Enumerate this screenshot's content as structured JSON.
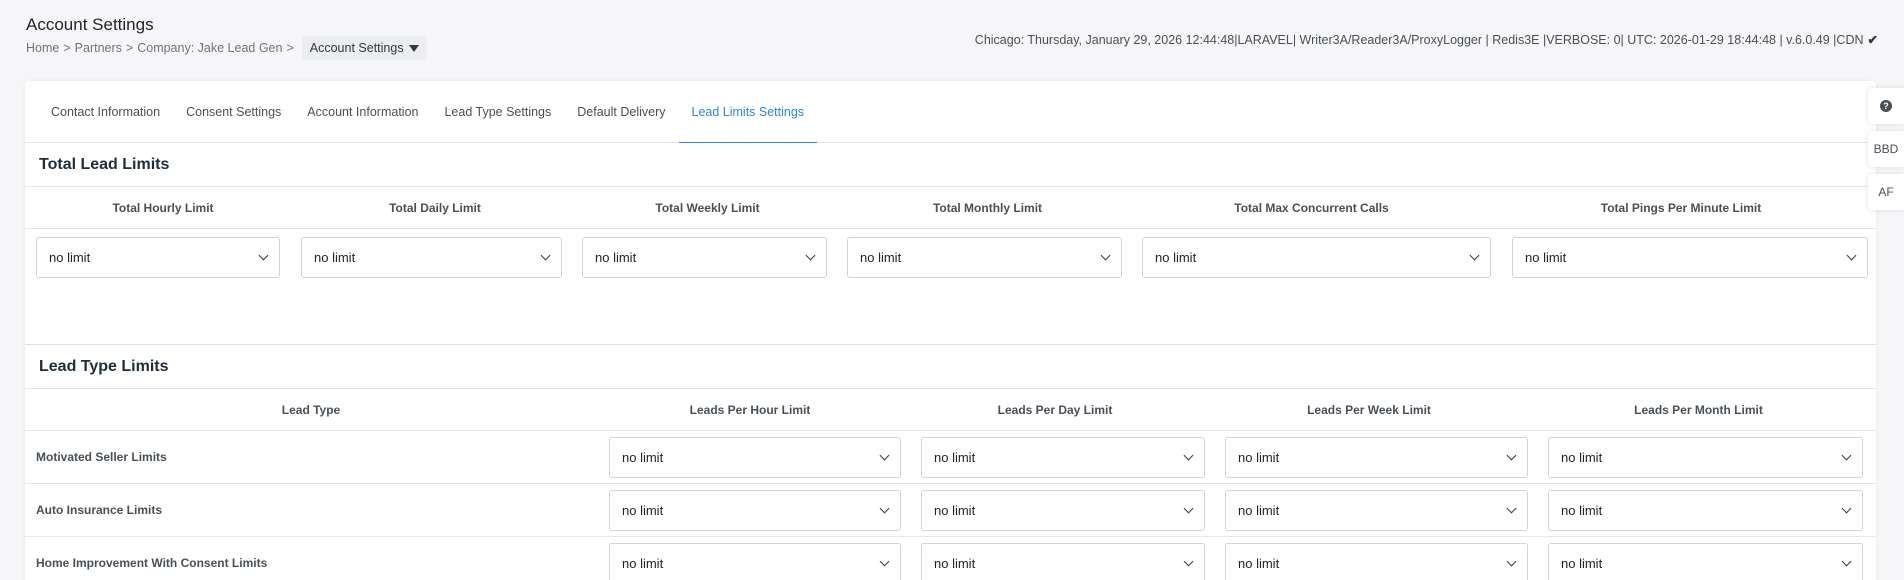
{
  "header": {
    "title": "Account Settings",
    "breadcrumb": [
      "Home",
      "Partners",
      "Company: Jake Lead Gen"
    ],
    "breadcrumb_separator": ">",
    "current": "Account Settings"
  },
  "status": "Chicago: Thursday, January 29, 2026 12:44:48|LARAVEL| Writer3A/Reader3A/ProxyLogger | Redis3E |VERBOSE: 0| UTC: 2026-01-29 18:44:48 | v.6.0.49 |CDN",
  "tabs": [
    "Contact Information",
    "Consent Settings",
    "Account Information",
    "Lead Type Settings",
    "Default Delivery",
    "Lead Limits Settings"
  ],
  "active_tab": "Lead Limits Settings",
  "total_limits": {
    "title": "Total Lead Limits",
    "columns": [
      "Total Hourly Limit",
      "Total Daily Limit",
      "Total Weekly Limit",
      "Total Monthly Limit",
      "Total Max Concurrent Calls",
      "Total Pings Per Minute Limit"
    ],
    "values": [
      "no limit",
      "no limit",
      "no limit",
      "no limit",
      "no limit",
      "no limit"
    ]
  },
  "lead_type_limits": {
    "title": "Lead Type Limits",
    "columns": [
      "Lead Type",
      "Leads Per Hour Limit",
      "Leads Per Day Limit",
      "Leads Per Week Limit",
      "Leads Per Month Limit"
    ],
    "rows": [
      {
        "name": "Motivated Seller Limits",
        "values": [
          "no limit",
          "no limit",
          "no limit",
          "no limit"
        ]
      },
      {
        "name": "Auto Insurance Limits",
        "values": [
          "no limit",
          "no limit",
          "no limit",
          "no limit"
        ]
      },
      {
        "name": "Home Improvement With Consent Limits",
        "values": [
          "no limit",
          "no limit",
          "no limit",
          "no limit"
        ]
      }
    ]
  },
  "side_tools": {
    "help_glyph": "?",
    "bbd": "BBD",
    "af": "AF"
  },
  "colors": {
    "accent": "#2e86de",
    "background": "#f6f6f8"
  }
}
